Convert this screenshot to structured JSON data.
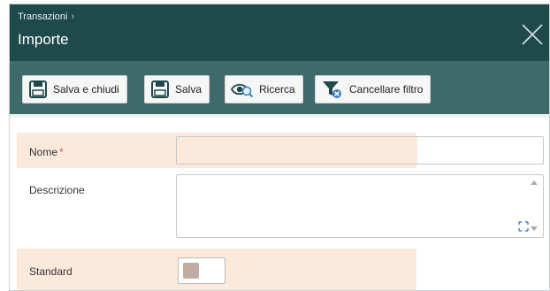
{
  "header": {
    "breadcrumb": "Transazioni",
    "breadcrumb_separator": "›",
    "title": "Importe",
    "close_icon": "close-icon",
    "background_color": "#1f4a4c"
  },
  "toolbar": {
    "background_color": "#3f6a6c",
    "buttons": [
      {
        "label": "Salva e chiudi",
        "icon": "save-icon"
      },
      {
        "label": "Salva",
        "icon": "save-icon"
      },
      {
        "label": "Ricerca",
        "icon": "eye-search-icon"
      },
      {
        "label": "Cancellare filtro",
        "icon": "funnel-clear-icon"
      }
    ]
  },
  "form": {
    "highlight_color": "#fbe9dc",
    "fields": {
      "nome": {
        "label": "Nome",
        "required_marker": "*",
        "value": ""
      },
      "descrizione": {
        "label": "Descrizione",
        "value": ""
      },
      "standard": {
        "label": "Standard",
        "checked": false
      }
    }
  }
}
